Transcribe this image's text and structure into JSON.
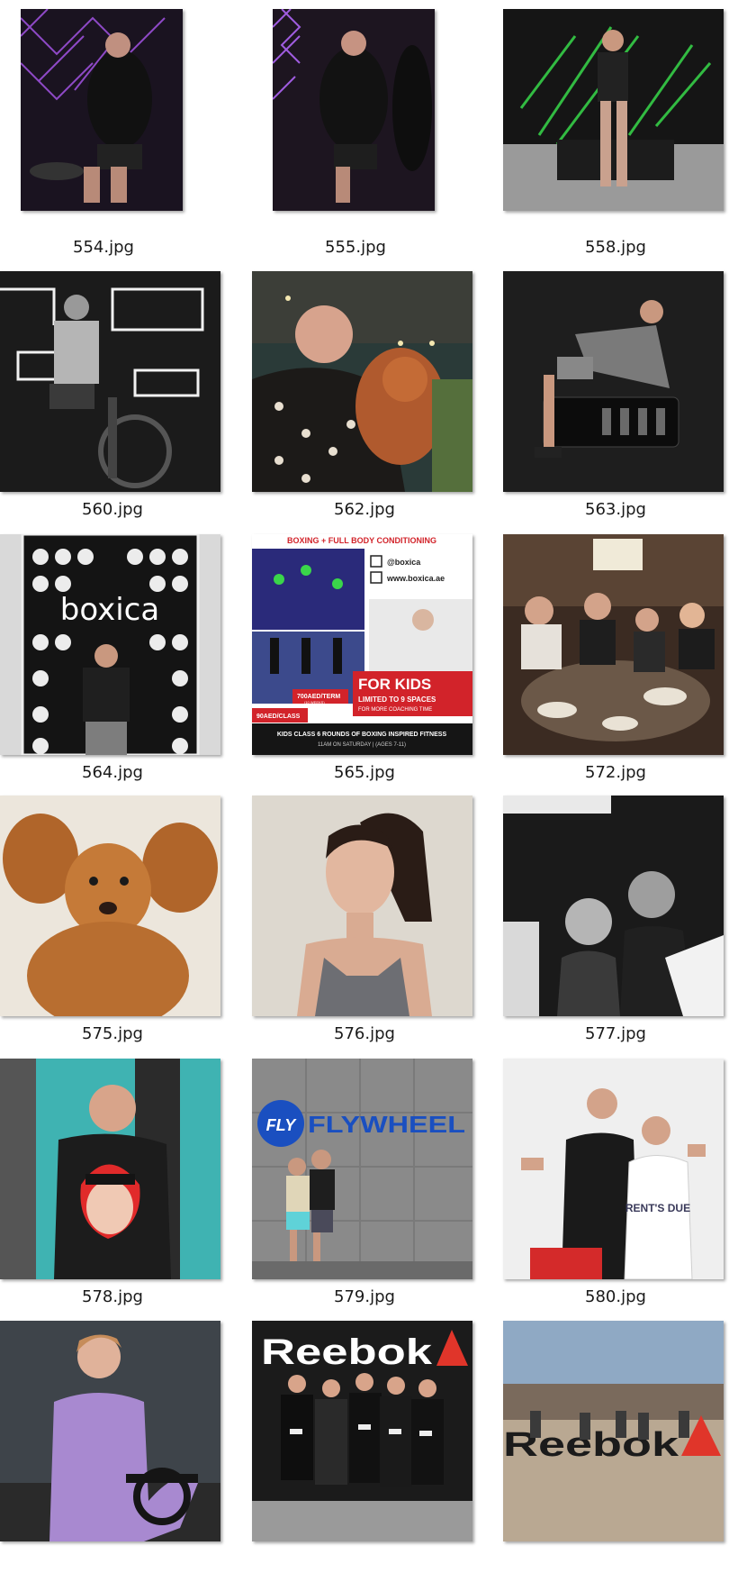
{
  "files": [
    {
      "filename": "554.jpg"
    },
    {
      "filename": "555.jpg"
    },
    {
      "filename": "558.jpg"
    },
    {
      "filename": "560.jpg"
    },
    {
      "filename": "562.jpg"
    },
    {
      "filename": "563.jpg"
    },
    {
      "filename": "564.jpg",
      "sign_text": "boxica"
    },
    {
      "filename": "565.jpg",
      "flyer": {
        "header": "BOXING + FULL BODY CONDITIONING",
        "handle": "@boxica",
        "website": "www.boxica.ae",
        "headline": "FOR KIDS",
        "subline": "LIMITED TO 9 SPACES",
        "subline2": "FOR MORE COACHING TIME",
        "price1": "700AED/TERM",
        "price1_note": "(10 WEEKS)",
        "price2": "90AED/CLASS",
        "footer": "KIDS CLASS 6 ROUNDS OF BOXING INSPIRED FITNESS",
        "footer2": "11AM ON SATURDAY | (AGES 7-11)"
      }
    },
    {
      "filename": "572.jpg"
    },
    {
      "filename": "575.jpg"
    },
    {
      "filename": "576.jpg"
    },
    {
      "filename": "577.jpg"
    },
    {
      "filename": "578.jpg"
    },
    {
      "filename": "579.jpg",
      "sign_text": "FLYWHEEL",
      "badge_text": "FLY"
    },
    {
      "filename": "580.jpg",
      "shirt_text": "RENT'S DUE"
    },
    {
      "filename": "581.jpg"
    },
    {
      "filename": "582.jpg",
      "sign_text": "Reebok"
    },
    {
      "filename": "583.jpg",
      "sign_text": "Reebok"
    }
  ]
}
